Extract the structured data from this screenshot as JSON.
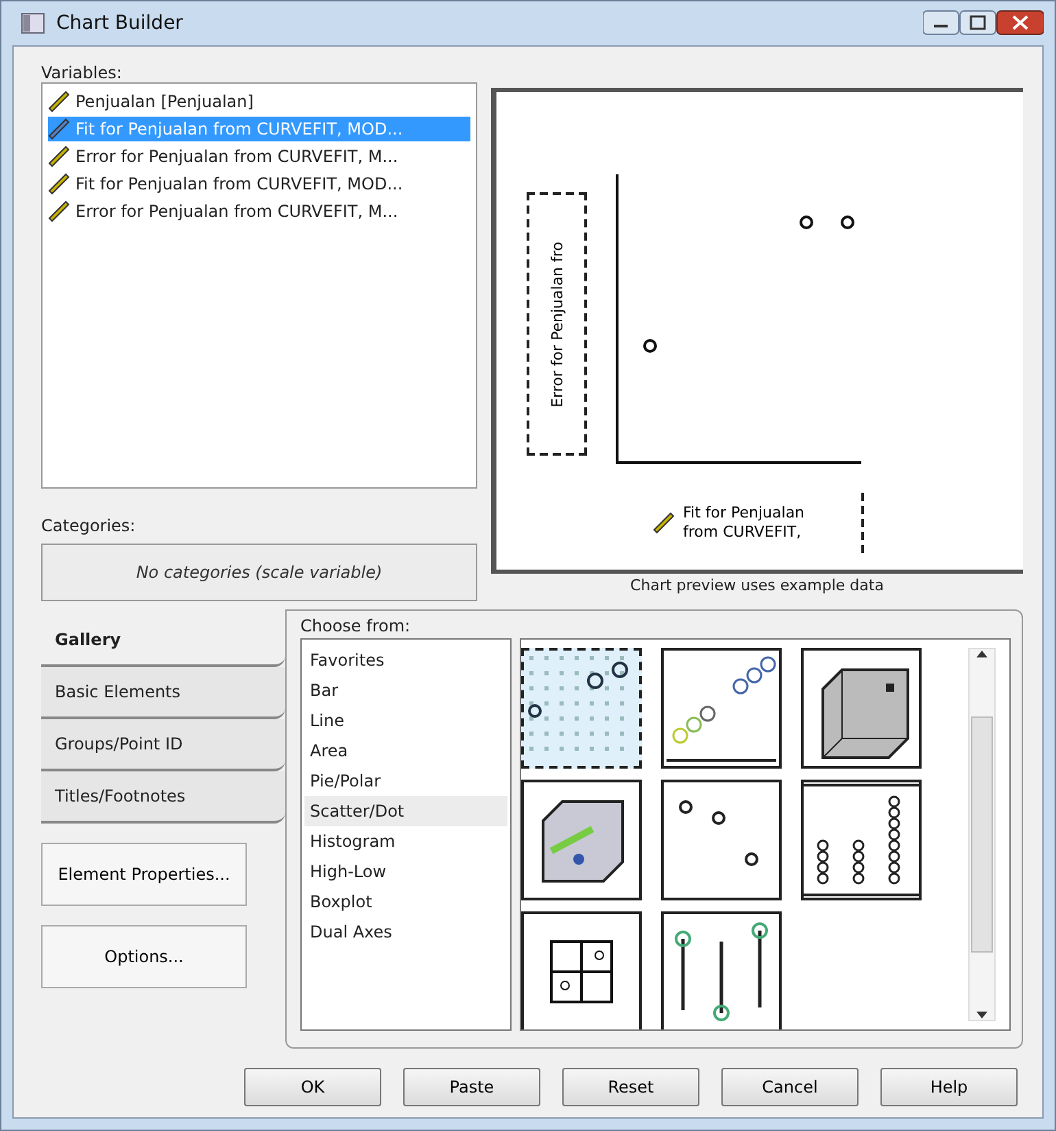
{
  "window": {
    "title": "Chart Builder"
  },
  "variables": {
    "label": "Variables:",
    "items": [
      {
        "name": "Penjualan [Penjualan]",
        "selected": false
      },
      {
        "name": "Fit for Penjualan from CURVEFIT, MOD...",
        "selected": true
      },
      {
        "name": "Error for Penjualan from CURVEFIT, M...",
        "selected": false
      },
      {
        "name": "Fit for Penjualan from CURVEFIT, MOD...",
        "selected": false
      },
      {
        "name": "Error for Penjualan from CURVEFIT, M...",
        "selected": false
      }
    ]
  },
  "categories": {
    "label": "Categories:",
    "value": "No categories (scale variable)"
  },
  "preview": {
    "y_drop": "Error for Penjualan fro",
    "x_drop": "Fit for Penjualan from CURVEFIT,",
    "note": "Chart preview uses example data"
  },
  "tabs": [
    {
      "label": "Gallery",
      "selected": true
    },
    {
      "label": "Basic Elements",
      "selected": false
    },
    {
      "label": "Groups/Point ID",
      "selected": false
    },
    {
      "label": "Titles/Footnotes",
      "selected": false
    }
  ],
  "side_buttons": [
    "Element Properties...",
    "Options..."
  ],
  "gallery": {
    "label": "Choose from:",
    "chart_types": [
      {
        "label": "Favorites",
        "selected": false
      },
      {
        "label": "Bar",
        "selected": false
      },
      {
        "label": "Line",
        "selected": false
      },
      {
        "label": "Area",
        "selected": false
      },
      {
        "label": "Pie/Polar",
        "selected": false
      },
      {
        "label": "Scatter/Dot",
        "selected": true
      },
      {
        "label": "Histogram",
        "selected": false
      },
      {
        "label": "High-Low",
        "selected": false
      },
      {
        "label": "Boxplot",
        "selected": false
      },
      {
        "label": "Dual Axes",
        "selected": false
      }
    ],
    "thumbnails": [
      {
        "kind": "grid",
        "selected": true
      },
      {
        "kind": "grouped",
        "selected": false
      },
      {
        "kind": "cube",
        "selected": false
      },
      {
        "kind": "cube_points",
        "selected": false
      },
      {
        "kind": "scatter",
        "selected": false
      },
      {
        "kind": "stack",
        "selected": false
      },
      {
        "kind": "matrix",
        "selected": false
      },
      {
        "kind": "drop_line",
        "selected": false
      }
    ]
  },
  "buttons": [
    "OK",
    "Paste",
    "Reset",
    "Cancel",
    "Help"
  ]
}
